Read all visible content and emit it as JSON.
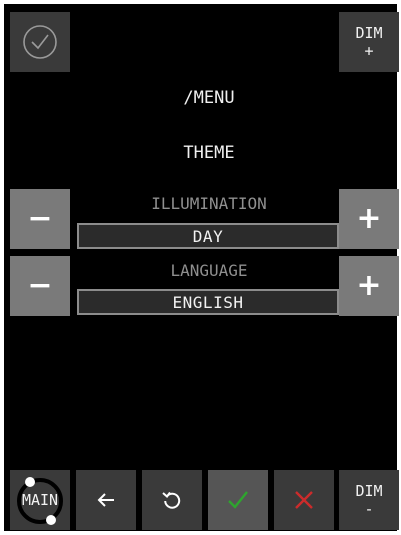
{
  "header": {
    "dim_plus": {
      "title": "DIM",
      "sub": "+"
    },
    "confirm_icon": "check-circle-icon"
  },
  "menu": {
    "path": "/MENU",
    "section": "THEME"
  },
  "settings": [
    {
      "label": "ILLUMINATION",
      "value": "DAY",
      "decrement": "−",
      "increment": "+"
    },
    {
      "label": "LANGUAGE",
      "value": "ENGLISH",
      "decrement": "−",
      "increment": "+"
    }
  ],
  "footer": {
    "main_label": "MAIN",
    "back_icon": "arrow-left-icon",
    "reset_icon": "refresh-icon",
    "accept_icon": "check-icon",
    "cancel_icon": "x-icon",
    "dim_minus": {
      "title": "DIM",
      "sub": "-"
    }
  },
  "colors": {
    "panel": "#000000",
    "button_dark": "#3a3a3a",
    "button_mid": "#7a7a7a",
    "accept": "#2ea52e",
    "cancel": "#cc2b2b",
    "label_muted": "#8f8f8f"
  }
}
